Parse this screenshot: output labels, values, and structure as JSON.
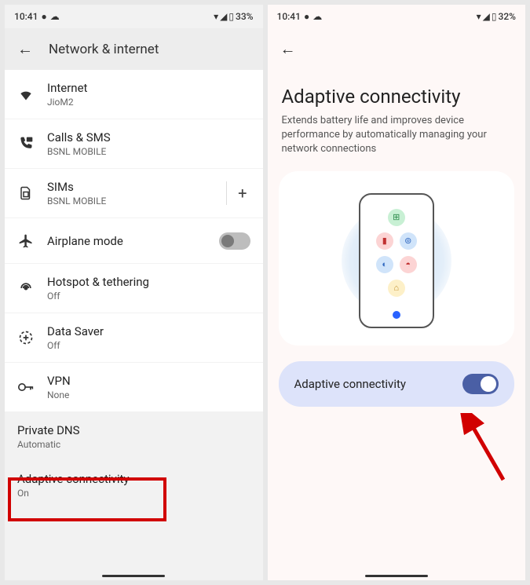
{
  "left": {
    "status": {
      "time": "10:41",
      "battery": "33%"
    },
    "header_title": "Network & internet",
    "items": [
      {
        "title": "Internet",
        "sub": "JioM2"
      },
      {
        "title": "Calls & SMS",
        "sub": "BSNL MOBILE"
      },
      {
        "title": "SIMs",
        "sub": "BSNL MOBILE"
      },
      {
        "title": "Airplane mode",
        "sub": ""
      },
      {
        "title": "Hotspot & tethering",
        "sub": "Off"
      },
      {
        "title": "Data Saver",
        "sub": "Off"
      },
      {
        "title": "VPN",
        "sub": "None"
      },
      {
        "title": "Private DNS",
        "sub": "Automatic"
      },
      {
        "title": "Adaptive connectivity",
        "sub": "On"
      }
    ]
  },
  "right": {
    "status": {
      "time": "10:41",
      "battery": "32%"
    },
    "page_title": "Adaptive connectivity",
    "page_subtitle": "Extends battery life and improves device performance by automatically managing your network connections",
    "toggle_label": "Adaptive connectivity",
    "toggle_state": true
  }
}
